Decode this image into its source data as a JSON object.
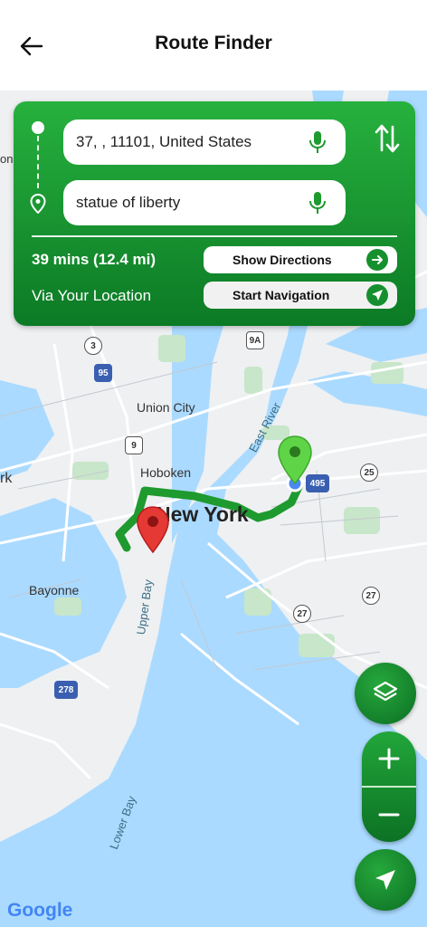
{
  "header": {
    "title": "Route Finder"
  },
  "route": {
    "origin": "37, , 11101, United States",
    "destination": "statue of liberty",
    "duration": "39 mins (12.4 mi)",
    "via": "Via Your Location",
    "show_directions": "Show Directions",
    "start_navigation": "Start Navigation"
  },
  "map": {
    "city": "New York",
    "labels": {
      "union_city": "Union City",
      "hoboken": "Hoboken",
      "bayonne": "Bayonne",
      "east_river": "East River",
      "upper_bay": "Upper Bay",
      "lower_bay": "Lower Bay",
      "left_edge_rk": "rk",
      "left_edge_on": "on"
    },
    "shields": {
      "s3": "3",
      "s95": "95",
      "s9": "9",
      "s9a": "9A",
      "s495": "495",
      "s25": "25",
      "s27a": "27",
      "s27b": "27",
      "s278": "278"
    },
    "attribution": "Google"
  },
  "colors": {
    "accent": "#16902f",
    "route": "#1e9a2e",
    "water": "#aadaff"
  }
}
